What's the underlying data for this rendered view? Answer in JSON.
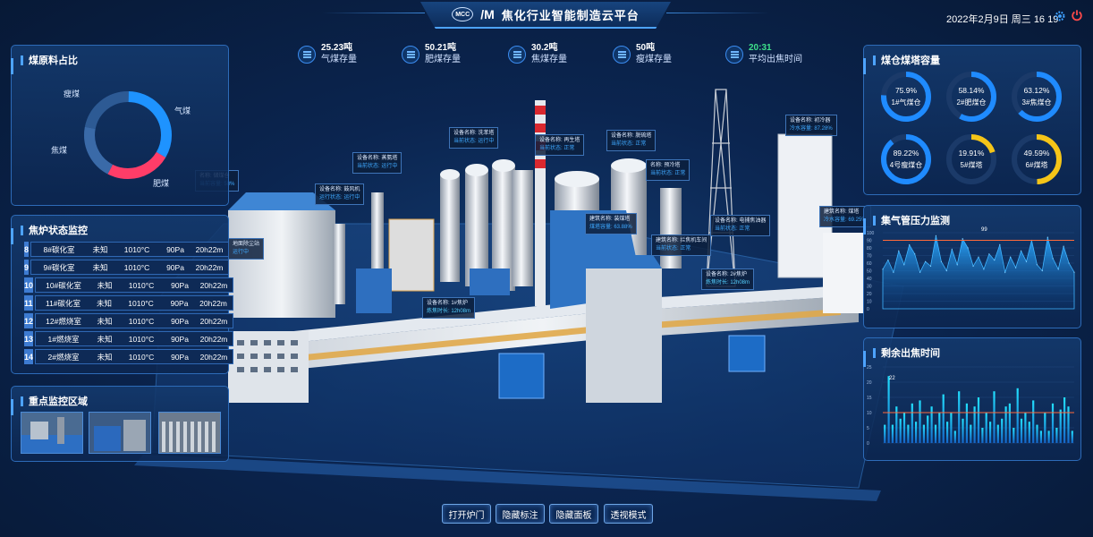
{
  "header": {
    "title": "焦化行业智能制造云平台",
    "logo_text": "MCC",
    "datetime": "2022年2月9日 周三 16   19"
  },
  "stats": [
    {
      "value": "25.23吨",
      "label": "气煤存量"
    },
    {
      "value": "50.21吨",
      "label": "肥煤存量"
    },
    {
      "value": "30.2吨",
      "label": "焦煤存量"
    },
    {
      "value": "50吨",
      "label": "瘦煤存量"
    },
    {
      "value": "20:31",
      "label": "平均出焦时间"
    }
  ],
  "coal_ratio": {
    "title": "煤原料占比",
    "labels": [
      "瘦煤",
      "气煤",
      "焦煤",
      "肥煤"
    ]
  },
  "oven_status": {
    "title": "焦炉状态监控",
    "rows": [
      {
        "num": "8",
        "name": "8#碳化室",
        "state": "未知",
        "temp": "1010°C",
        "pressure": "90Pa",
        "time": "20h22m"
      },
      {
        "num": "9",
        "name": "9#碳化室",
        "state": "未知",
        "temp": "1010°C",
        "pressure": "90Pa",
        "time": "20h22m"
      },
      {
        "num": "10",
        "name": "10#碳化室",
        "state": "未知",
        "temp": "1010°C",
        "pressure": "90Pa",
        "time": "20h22m"
      },
      {
        "num": "11",
        "name": "11#碳化室",
        "state": "未知",
        "temp": "1010°C",
        "pressure": "90Pa",
        "time": "20h22m"
      },
      {
        "num": "12",
        "name": "12#燃烧室",
        "state": "未知",
        "temp": "1010°C",
        "pressure": "90Pa",
        "time": "20h22m"
      },
      {
        "num": "13",
        "name": "1#燃烧室",
        "state": "未知",
        "temp": "1010°C",
        "pressure": "90Pa",
        "time": "20h22m"
      },
      {
        "num": "14",
        "name": "2#燃烧室",
        "state": "未知",
        "temp": "1010°C",
        "pressure": "90Pa",
        "time": "20h22m"
      }
    ]
  },
  "key_area": {
    "title": "重点监控区域"
  },
  "silo": {
    "title": "煤仓煤塔容量",
    "gauges": [
      {
        "value": "75.9%",
        "label": "1#气煤仓",
        "pct": 75.9,
        "color": "#1f8bff"
      },
      {
        "value": "58.14%",
        "label": "2#肥煤仓",
        "pct": 58.14,
        "color": "#1f8bff"
      },
      {
        "value": "63.12%",
        "label": "3#焦煤仓",
        "pct": 63.12,
        "color": "#1f8bff"
      },
      {
        "value": "89.22%",
        "label": "4号瘦煤仓",
        "pct": 89.22,
        "color": "#1f8bff"
      },
      {
        "value": "19.91%",
        "label": "5#煤塔",
        "pct": 19.91,
        "color": "#f5c518"
      },
      {
        "value": "49.59%",
        "label": "6#煤塔",
        "pct": 49.59,
        "color": "#f5c518"
      }
    ]
  },
  "pressure": {
    "title": "集气管压力监测",
    "peak_label": "99"
  },
  "remaining": {
    "title": "剩余出焦时间",
    "peak_label": "22"
  },
  "chart_data": [
    {
      "type": "area",
      "title": "集气管压力监测",
      "ylim": [
        0,
        100
      ],
      "yticks": [
        "100",
        "90",
        "80",
        "70",
        "60",
        "50",
        "40",
        "30",
        "20",
        "10",
        "0"
      ],
      "reference_line": 90,
      "values": [
        52,
        64,
        48,
        76,
        58,
        84,
        72,
        48,
        62,
        56,
        96,
        62,
        50,
        78,
        58,
        92,
        80,
        56,
        68,
        52,
        72,
        64,
        84,
        48,
        68,
        54,
        76,
        62,
        90,
        58,
        50,
        94,
        66,
        52,
        82,
        60,
        48
      ],
      "annotation": "99"
    },
    {
      "type": "bar",
      "title": "剩余出焦时间",
      "ylim": [
        0,
        25
      ],
      "yticks": [
        "25",
        "20",
        "15",
        "10",
        "5",
        "0"
      ],
      "reference_line": 10,
      "values": [
        6,
        22,
        6,
        12,
        8,
        10,
        6,
        13,
        7,
        14,
        6,
        9,
        12,
        6,
        10,
        16,
        7,
        10,
        4,
        17,
        8,
        13,
        6,
        12,
        15,
        5,
        10,
        7,
        17,
        6,
        8,
        12,
        13,
        5,
        18,
        8,
        10,
        7,
        14,
        6,
        4,
        10,
        4,
        13,
        5,
        11,
        15,
        12,
        4
      ],
      "annotation": "22"
    }
  ],
  "plant_tags": [
    {
      "l1": "设备名称: 鼓风机",
      "l2": "运行状态: 运行中"
    },
    {
      "l1": "设备名称: 洗苯塔",
      "l2": "当前状态: 运行中"
    },
    {
      "l1": "设备名称: 再生塔",
      "l2": "当前状态: 正常"
    },
    {
      "l1": "设备名称: 脱硫塔",
      "l2": "当前状态: 正常"
    },
    {
      "l1": "设备名称: 初冷器",
      "l2": "冷水容量: 87.28%"
    },
    {
      "l1": "设备名称: 蒸氨塔",
      "l2": "当前状态: 运行中"
    },
    {
      "l1": "设备名称: 脱苯塔",
      "l2": "当前状态: 运行中"
    },
    {
      "l1": "名称: 预冷塔",
      "l2": "当前状态: 正常"
    },
    {
      "l1": "设备名称: 电捕焦油器",
      "l2": "当前状态: 正常"
    },
    {
      "l1": "建筑名称: 煤塔",
      "l2": "冷水容量: 69.25%"
    },
    {
      "l1": "建筑名称: 装煤塔",
      "l2": "煤塔容量: 63.88%"
    },
    {
      "l1": "建筑名称: 拦焦机车间",
      "l2": "当前状态: 正常"
    },
    {
      "l1": "设备名称: 1#焦炉",
      "l2": "炼焦时长: 12h08m"
    },
    {
      "l1": "设备名称: 2#焦炉",
      "l2": "炼焦时长: 12h08m"
    },
    {
      "l1": "名称: 储煤仓",
      "l2": "当前容量: 58%"
    },
    {
      "l1": "地面除尘站",
      "l2": "运行中"
    }
  ],
  "buttons": [
    "打开炉门",
    "隐藏标注",
    "隐藏面板",
    "透视模式"
  ]
}
